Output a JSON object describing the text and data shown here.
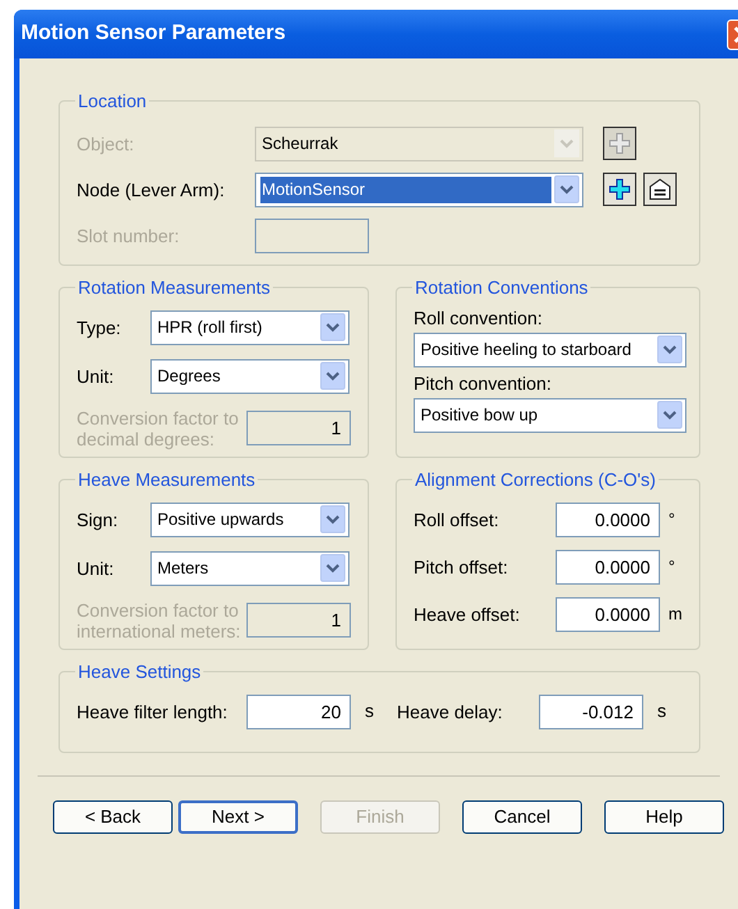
{
  "window": {
    "title": "Motion Sensor Parameters"
  },
  "location": {
    "title": "Location",
    "fields": [
      {
        "kind": "combo",
        "label": "Object:",
        "value": "Scheurrak",
        "disabled": true,
        "selected": false,
        "tools": [
          {
            "kind": "add",
            "disabled": true
          }
        ]
      },
      {
        "kind": "combo",
        "label": "Node (Lever Arm):",
        "value": "MotionSensor",
        "disabled": false,
        "selected": true,
        "tools": [
          {
            "kind": "add",
            "disabled": false
          },
          {
            "kind": "properties",
            "disabled": false
          }
        ]
      },
      {
        "kind": "text",
        "label": "Slot number:",
        "disabled": true
      }
    ]
  },
  "rotation_measurements": {
    "title": "Rotation Measurements",
    "fields": [
      {
        "kind": "combo",
        "label": "Type:",
        "value": "HPR (roll first)",
        "disabled": false
      },
      {
        "kind": "combo",
        "label": "Unit:",
        "value": "Degrees",
        "disabled": false
      },
      {
        "kind": "text",
        "label": "Conversion factor to decimal degrees:",
        "value": "1",
        "disabled": true
      }
    ]
  },
  "rotation_conventions": {
    "title": "Rotation Conventions",
    "fields": [
      {
        "label": "Roll convention:",
        "value": "Positive heeling to starboard"
      },
      {
        "label": "Pitch convention:",
        "value": "Positive bow up"
      }
    ]
  },
  "heave_measurements": {
    "title": "Heave Measurements",
    "fields": [
      {
        "kind": "combo",
        "label": "Sign:",
        "value": "Positive upwards",
        "disabled": false
      },
      {
        "kind": "combo",
        "label": "Unit:",
        "value": "Meters",
        "disabled": false
      },
      {
        "kind": "text",
        "label": "Conversion factor to international meters:",
        "value": "1",
        "disabled": true
      }
    ]
  },
  "alignment_corrections": {
    "title": "Alignment Corrections (C-O's)",
    "fields": [
      {
        "label": "Roll offset:",
        "value": "0.0000",
        "unit": "°"
      },
      {
        "label": "Pitch offset:",
        "value": "0.0000",
        "unit": "°"
      },
      {
        "label": "Heave offset:",
        "value": "0.0000",
        "unit": "m"
      }
    ]
  },
  "heave_settings": {
    "title": "Heave Settings",
    "fields": [
      {
        "label": "Heave filter length:",
        "value": "20",
        "unit": "s"
      },
      {
        "label": "Heave delay:",
        "value": "-0.012",
        "unit": "s"
      }
    ]
  },
  "buttons": [
    {
      "label": "< Back",
      "disabled": false,
      "default": false
    },
    {
      "label": "Next >",
      "disabled": false,
      "default": true
    },
    {
      "label": "Finish",
      "disabled": true,
      "default": false
    },
    {
      "label": "Cancel",
      "disabled": false,
      "default": false
    },
    {
      "label": "Help",
      "disabled": false,
      "default": false
    }
  ]
}
